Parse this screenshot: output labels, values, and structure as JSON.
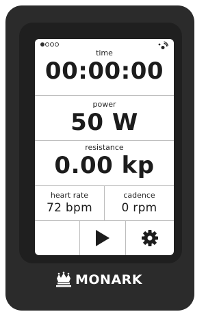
{
  "status": {
    "page_dots": 4,
    "active_dot": 0,
    "signal_icon": "signal-icon"
  },
  "time": {
    "label": "time",
    "value": "00:00:00"
  },
  "power": {
    "label": "power",
    "value": "50 W"
  },
  "resistance": {
    "label": "resistance",
    "value": "0.00 kp"
  },
  "heart_rate": {
    "label": "heart rate",
    "value": "72 bpm"
  },
  "cadence": {
    "label": "cadence",
    "value": "0 rpm"
  },
  "buttons": {
    "play_icon": "play-icon",
    "settings_icon": "gear-icon"
  },
  "brand": {
    "name": "MONARK",
    "logo_icon": "crown-icon"
  },
  "colors": {
    "device": "#2b2b2b",
    "bezel": "#1f1f1f",
    "screen": "#ffffff",
    "text": "#1c1c1c",
    "divider": "#bdbdbd"
  }
}
